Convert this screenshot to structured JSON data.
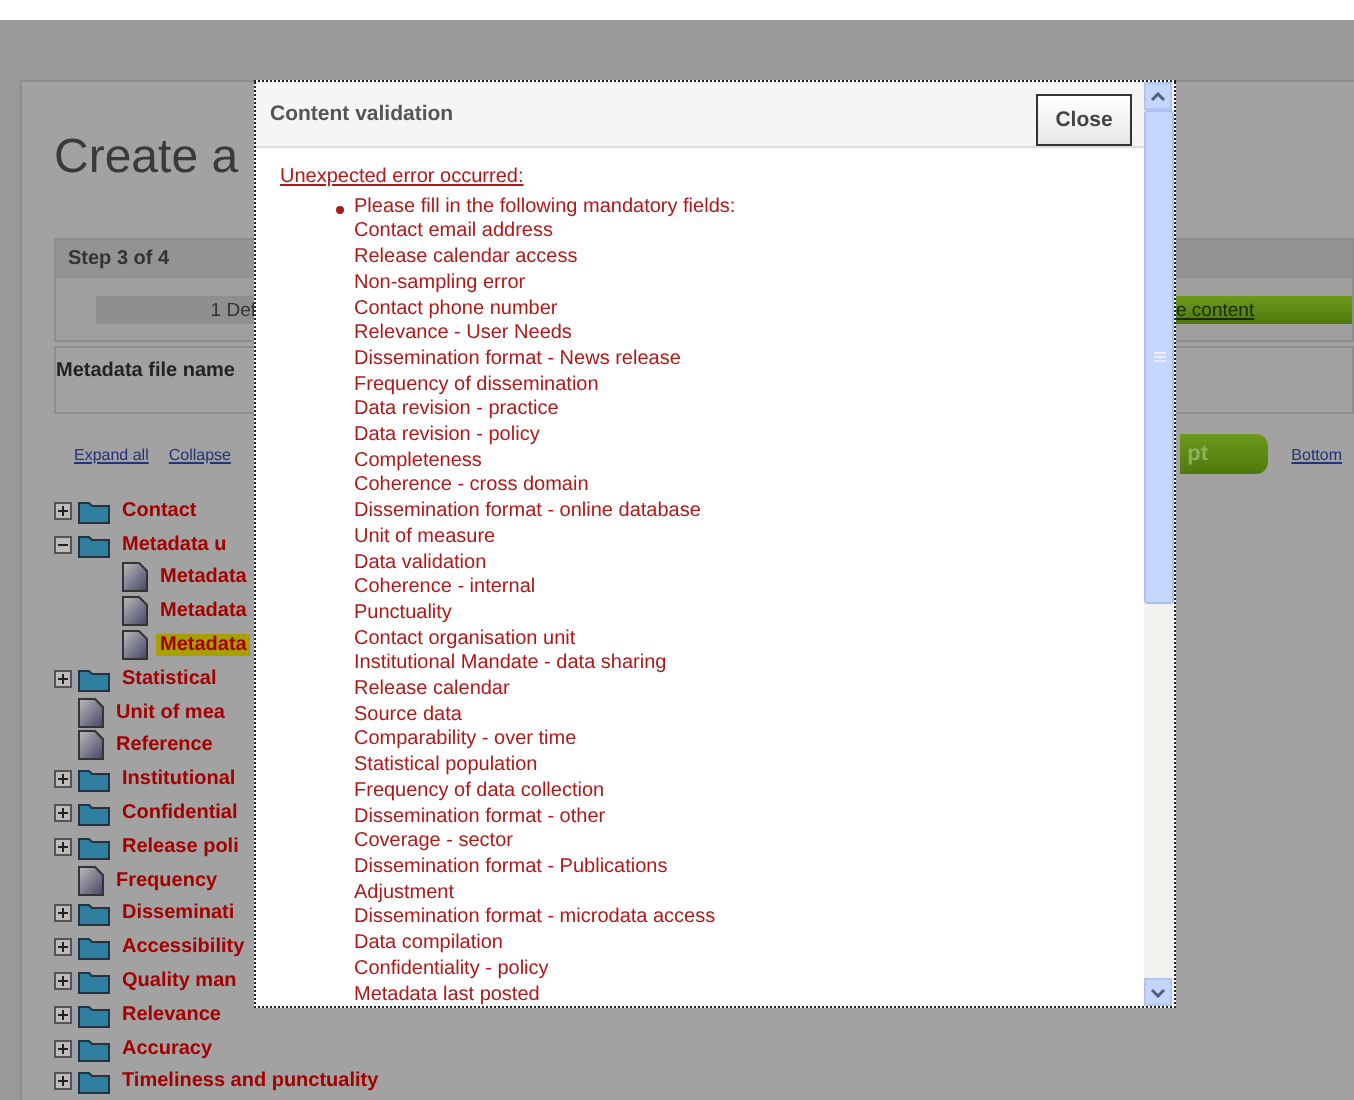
{
  "page": {
    "title": "Create a",
    "step": "Step 3 of 4",
    "progress": [
      {
        "label": "1 Def",
        "done": false
      },
      {
        "label": "e content",
        "done": true
      }
    ],
    "file_name_label": "Metadata file name",
    "links": [
      "Expand all",
      "Collapse"
    ],
    "accept_button": "pt",
    "bottom_link": "Bottom",
    "tree": [
      {
        "label": "Contact",
        "kind": "folder",
        "expanded": false,
        "selected": false
      },
      {
        "label": "Metadata u",
        "kind": "folder",
        "expanded": true,
        "selected": false,
        "children": [
          {
            "label": "Metadata",
            "kind": "document",
            "selected": false
          },
          {
            "label": "Metadata",
            "kind": "document",
            "selected": false
          },
          {
            "label": "Metadata",
            "kind": "document",
            "selected": true
          }
        ]
      },
      {
        "label": "Statistical",
        "kind": "folder",
        "expanded": false,
        "selected": false
      },
      {
        "label": "Unit of mea",
        "kind": "document",
        "selected": false
      },
      {
        "label": "Reference",
        "kind": "document",
        "selected": false
      },
      {
        "label": "Institutional",
        "kind": "folder",
        "expanded": false,
        "selected": false
      },
      {
        "label": "Confidential",
        "kind": "folder",
        "expanded": false,
        "selected": false
      },
      {
        "label": "Release poli",
        "kind": "folder",
        "expanded": false,
        "selected": false
      },
      {
        "label": "Frequency",
        "kind": "document",
        "selected": false
      },
      {
        "label": "Disseminati",
        "kind": "folder",
        "expanded": false,
        "selected": false
      },
      {
        "label": "Accessibility",
        "kind": "folder",
        "expanded": false,
        "selected": false
      },
      {
        "label": "Quality man",
        "kind": "folder",
        "expanded": false,
        "selected": false
      },
      {
        "label": "Relevance",
        "kind": "folder",
        "expanded": false,
        "selected": false
      },
      {
        "label": "Accuracy",
        "kind": "folder",
        "expanded": false,
        "selected": false
      },
      {
        "label": "Timeliness and punctuality",
        "kind": "folder",
        "expanded": false,
        "selected": false
      }
    ]
  },
  "dialog": {
    "title": "Content validation",
    "close_button": "Close",
    "error_heading": "Unexpected error occurred:",
    "message": "Please fill in the following mandatory fields:",
    "fields": [
      "Contact email address",
      "Release calendar access",
      "Non-sampling error",
      "Contact phone number",
      "Relevance - User Needs",
      "Dissemination format - News release",
      "Frequency of dissemination",
      "Data revision - practice",
      "Data revision - policy",
      "Completeness",
      "Coherence - cross domain",
      "Dissemination format - online database",
      "Unit of measure",
      "Data validation",
      "Coherence - internal",
      "Punctuality",
      "Contact organisation unit",
      "Institutional Mandate - data sharing",
      "Release calendar",
      "Source data",
      "Comparability - over time",
      "Statistical population",
      "Frequency of data collection",
      "Dissemination format - other",
      "Coverage - sector",
      "Dissemination format - Publications",
      "Adjustment",
      "Dissemination format - microdata access",
      "Data compilation",
      "Confidentiality - policy",
      "Metadata last posted"
    ]
  }
}
